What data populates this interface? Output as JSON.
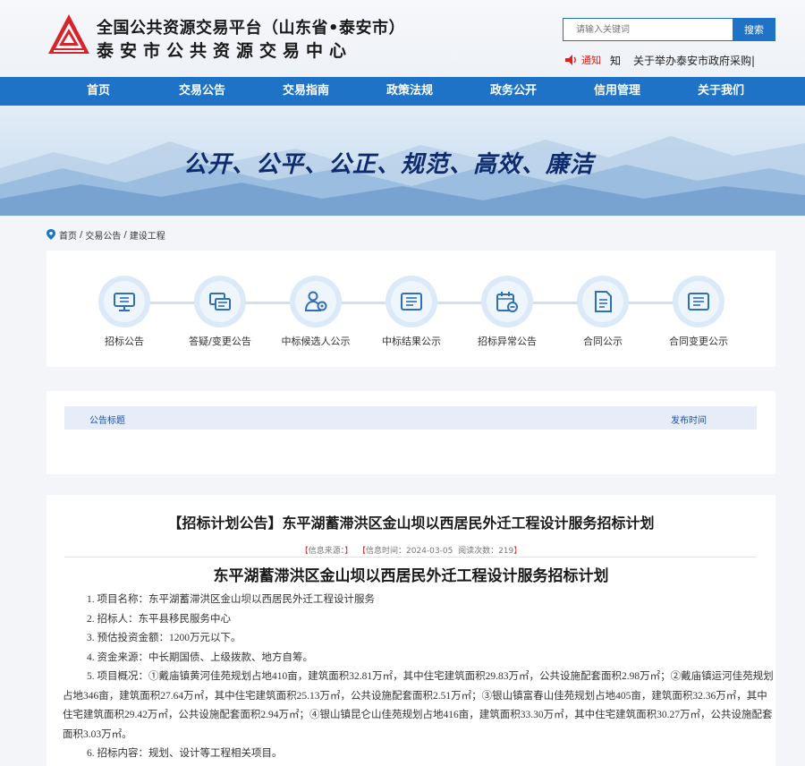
{
  "header": {
    "title_line1": "全国公共资源交易平台（山东省•泰安市）",
    "title_line2": "泰安市公共资源交易中心",
    "search_placeholder": "请输入关键词",
    "search_button": "搜索",
    "notice_tag": "通知",
    "notice_text": "知",
    "notice_text2": "关于举办泰安市政府采购|"
  },
  "nav": {
    "items": [
      "首页",
      "交易公告",
      "交易指南",
      "政策法规",
      "政务公开",
      "信用管理",
      "关于我们"
    ]
  },
  "banner": {
    "slogan": "公开、公平、公正、规范、高效、廉洁"
  },
  "breadcrumb": {
    "items": [
      "首页",
      "交易公告",
      "建设工程"
    ],
    "separator": "/"
  },
  "categories": [
    {
      "label": "招标公告",
      "icon": "monitor-icon"
    },
    {
      "label": "答疑/变更公告",
      "icon": "cards-icon"
    },
    {
      "label": "中标候选人公示",
      "icon": "user-badge-icon"
    },
    {
      "label": "中标结果公示",
      "icon": "list-icon"
    },
    {
      "label": "招标异常公告",
      "icon": "calendar-minus-icon"
    },
    {
      "label": "合同公示",
      "icon": "document-icon"
    },
    {
      "label": "合同变更公示",
      "icon": "list-icon"
    }
  ],
  "list": {
    "col_title": "公告标题",
    "col_time": "发布时间"
  },
  "article": {
    "title": "【招标计划公告】东平湖蓄滞洪区金山坝以西居民外迁工程设计服务招标计划",
    "meta_source": "信息来源：",
    "meta_time": "信息时间：2024-03-05",
    "meta_views": "阅读次数：",
    "meta_views_count": "219",
    "heading": "东平湖蓄滞洪区金山坝以西居民外迁工程设计服务招标计划",
    "paragraphs": [
      "1. 项目名称：东平湖蓄滞洪区金山坝以西居民外迁工程设计服务",
      "2. 招标人：东平县移民服务中心",
      "3. 预估投资金额：1200万元以下。",
      "4. 资金来源：中长期国债、上级拨款、地方自筹。",
      "5. 项目概况：①戴庙镇黄河佳苑规划占地410亩，建筑面积32.81万㎡，其中住宅建筑面积29.83万㎡，公共设施配套面积2.98万㎡；②戴庙镇运河佳苑规划占地346亩，建筑面积27.64万㎡，其中住宅建筑面积25.13万㎡，公共设施配套面积2.51万㎡；③银山镇富春山佳苑规划占地405亩，建筑面积32.36万㎡，其中住宅建筑面积29.42万㎡，公共设施配套面积2.94万㎡；④银山镇昆仑山佳苑规划占地416亩，建筑面积33.30万㎡，其中住宅建筑面积30.27万㎡，公共设施配套面积3.03万㎡。",
      "6. 招标内容：规划、设计等工程相关项目。"
    ]
  },
  "colors": {
    "primary": "#1e73c6",
    "logo_red": "#d8232a",
    "slogan": "#0f2b6e",
    "notice_red": "#e02020"
  }
}
